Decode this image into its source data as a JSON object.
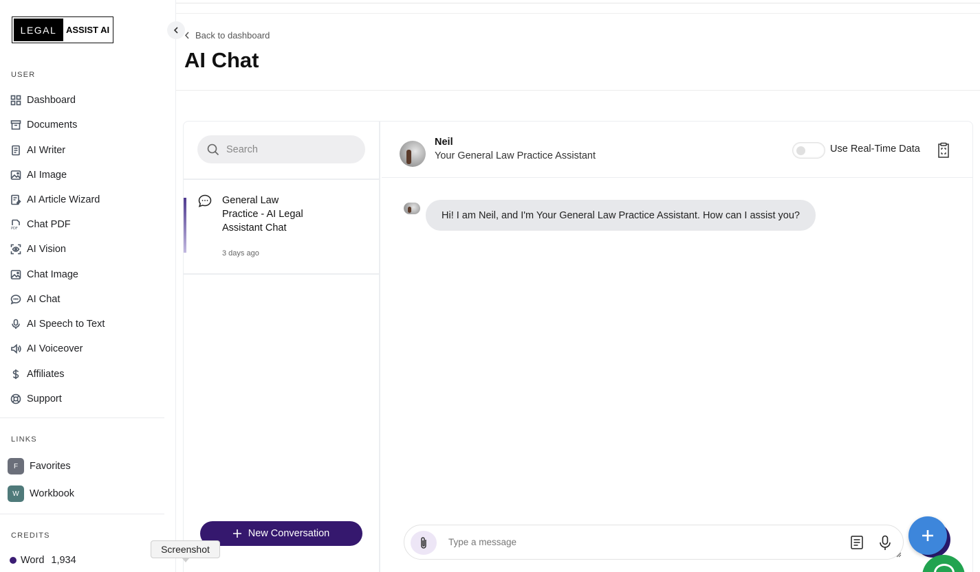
{
  "sidebar": {
    "logo_left": "LEGAL",
    "logo_right": "ASSIST AI",
    "user_section": "USER",
    "items": [
      {
        "label": "Dashboard",
        "icon": "grid-icon"
      },
      {
        "label": "Documents",
        "icon": "archive-icon"
      },
      {
        "label": "AI Writer",
        "icon": "document-icon"
      },
      {
        "label": "AI Image",
        "icon": "image-icon"
      },
      {
        "label": "AI Article Wizard",
        "icon": "article-wizard-icon"
      },
      {
        "label": "Chat PDF",
        "icon": "pdf-icon"
      },
      {
        "label": "AI Vision",
        "icon": "scan-eye-icon"
      },
      {
        "label": "Chat Image",
        "icon": "image-icon"
      },
      {
        "label": "AI Chat",
        "icon": "chat-bubble-icon"
      },
      {
        "label": "AI Speech to Text",
        "icon": "microphone-icon"
      },
      {
        "label": "AI Voiceover",
        "icon": "speaker-icon"
      },
      {
        "label": "Affiliates",
        "icon": "dollar-icon"
      },
      {
        "label": "Support",
        "icon": "lifebuoy-icon"
      }
    ],
    "links_section": "LINKS",
    "links": [
      {
        "badge": "F",
        "label": "Favorites",
        "color": "#6b6f7a"
      },
      {
        "badge": "W",
        "label": "Workbook",
        "color": "#4f7a7a"
      }
    ],
    "credits_section": "CREDITS",
    "credits": [
      {
        "label": "Word",
        "value": "1,934"
      }
    ],
    "tooltip": "Screenshot"
  },
  "header": {
    "back_label": "Back to dashboard",
    "title": "AI Chat"
  },
  "conversations": {
    "search_placeholder": "Search",
    "items": [
      {
        "title": "General Law Practice - AI Legal Assistant Chat",
        "time": "3 days ago"
      }
    ],
    "new_button": "New Conversation"
  },
  "chat": {
    "assistant_name": "Neil",
    "assistant_role": "Your General Law Practice Assistant",
    "realtime_label": "Use Real-Time Data",
    "realtime_enabled": false,
    "messages": [
      {
        "from": "assistant",
        "text": "Hi! I am Neil, and I'm Your General Law Practice Assistant. How can I assist you?"
      }
    ],
    "input_placeholder": "Type a message"
  },
  "colors": {
    "primary": "#35186e",
    "fab": "#3d86db",
    "whatsapp": "#22a350"
  }
}
